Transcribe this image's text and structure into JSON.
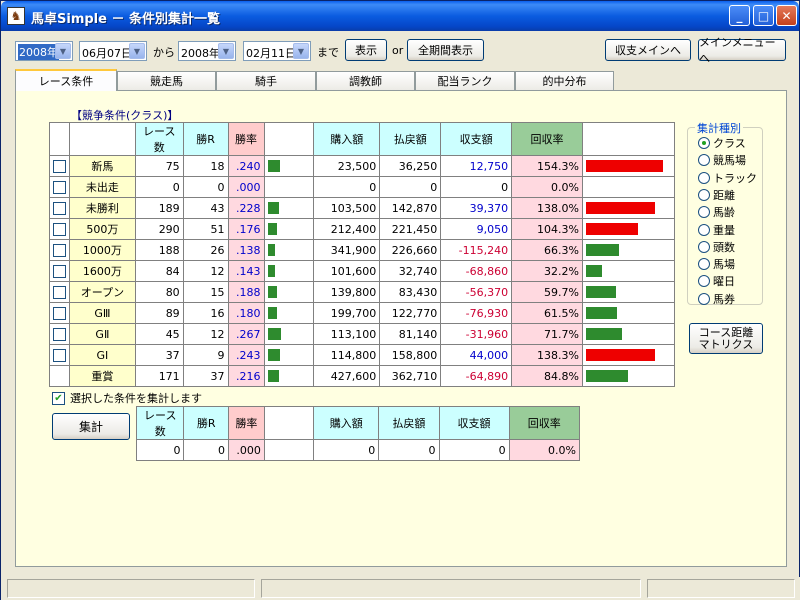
{
  "window": {
    "title": "馬卓Simple － 条件別集計一覧",
    "icon": "horse-app-icon",
    "min_glyph": "_",
    "max_glyph": "□",
    "close_glyph": "✕"
  },
  "filters": {
    "from_year": "2008年",
    "from_date": "06月07日",
    "from_label": "から",
    "to_year": "2008年",
    "to_date": "02月11日",
    "to_label": "まで",
    "show_button": "表示",
    "or_label": "or",
    "all_period_button": "全期間表示",
    "income_main_button": "収支メインへ",
    "main_menu_button": "メインメニューへ"
  },
  "tabs": [
    "レース条件",
    "競走馬",
    "騎手",
    "調教師",
    "配当ランク",
    "的中分布"
  ],
  "section_title": "【競争条件(クラス)】",
  "table": {
    "headers": [
      "レース数",
      "勝R",
      "勝率",
      "購入額",
      "払戻額",
      "収支額",
      "回収率"
    ],
    "rows": [
      {
        "label": "新馬",
        "races": "75",
        "wins": "18",
        "rate": ".240",
        "rate_value": 0.24,
        "buy": "23,500",
        "payout": "36,250",
        "balance": "12,750",
        "balance_sign": "pos",
        "recovery": "154.3%",
        "recovery_value": 154.3
      },
      {
        "label": "未出走",
        "races": "0",
        "wins": "0",
        "rate": ".000",
        "rate_value": 0.0,
        "buy": "0",
        "payout": "0",
        "balance": "0",
        "balance_sign": "zero",
        "recovery": "0.0%",
        "recovery_value": 0.0
      },
      {
        "label": "未勝利",
        "races": "189",
        "wins": "43",
        "rate": ".228",
        "rate_value": 0.228,
        "buy": "103,500",
        "payout": "142,870",
        "balance": "39,370",
        "balance_sign": "pos",
        "recovery": "138.0%",
        "recovery_value": 138.0
      },
      {
        "label": "500万",
        "races": "290",
        "wins": "51",
        "rate": ".176",
        "rate_value": 0.176,
        "buy": "212,400",
        "payout": "221,450",
        "balance": "9,050",
        "balance_sign": "pos",
        "recovery": "104.3%",
        "recovery_value": 104.3
      },
      {
        "label": "1000万",
        "races": "188",
        "wins": "26",
        "rate": ".138",
        "rate_value": 0.138,
        "buy": "341,900",
        "payout": "226,660",
        "balance": "-115,240",
        "balance_sign": "neg",
        "recovery": "66.3%",
        "recovery_value": 66.3
      },
      {
        "label": "1600万",
        "races": "84",
        "wins": "12",
        "rate": ".143",
        "rate_value": 0.143,
        "buy": "101,600",
        "payout": "32,740",
        "balance": "-68,860",
        "balance_sign": "neg",
        "recovery": "32.2%",
        "recovery_value": 32.2
      },
      {
        "label": "オープン",
        "races": "80",
        "wins": "15",
        "rate": ".188",
        "rate_value": 0.188,
        "buy": "139,800",
        "payout": "83,430",
        "balance": "-56,370",
        "balance_sign": "neg",
        "recovery": "59.7%",
        "recovery_value": 59.7
      },
      {
        "label": "GⅢ",
        "races": "89",
        "wins": "16",
        "rate": ".180",
        "rate_value": 0.18,
        "buy": "199,700",
        "payout": "122,770",
        "balance": "-76,930",
        "balance_sign": "neg",
        "recovery": "61.5%",
        "recovery_value": 61.5
      },
      {
        "label": "GⅡ",
        "races": "45",
        "wins": "12",
        "rate": ".267",
        "rate_value": 0.267,
        "buy": "113,100",
        "payout": "81,140",
        "balance": "-31,960",
        "balance_sign": "neg",
        "recovery": "71.7%",
        "recovery_value": 71.7
      },
      {
        "label": "GⅠ",
        "races": "37",
        "wins": "9",
        "rate": ".243",
        "rate_value": 0.243,
        "buy": "114,800",
        "payout": "158,800",
        "balance": "44,000",
        "balance_sign": "pos",
        "recovery": "138.3%",
        "recovery_value": 138.3
      },
      {
        "label": "重賞",
        "races": "171",
        "wins": "37",
        "rate": ".216",
        "rate_value": 0.216,
        "buy": "427,600",
        "payout": "362,710",
        "balance": "-64,890",
        "balance_sign": "neg",
        "recovery": "84.8%",
        "recovery_value": 84.8
      }
    ]
  },
  "selection": {
    "checkbox_label": "選択した条件を集計します",
    "checked": true,
    "aggregate_button": "集計",
    "summary": {
      "races": "0",
      "wins": "0",
      "rate": ".000",
      "buy": "0",
      "payout": "0",
      "balance": "0",
      "recovery": "0.0%"
    }
  },
  "aggregate_type": {
    "title": "集計種別",
    "options": [
      "クラス",
      "競馬場",
      "トラック",
      "距離",
      "馬齢",
      "重量",
      "頭数",
      "馬場",
      "曜日",
      "馬券"
    ],
    "selected": "クラス"
  },
  "course_matrix_button": [
    "コース距離",
    "マトリクス"
  ],
  "colors": {
    "positive": "#0000CC",
    "negative": "#CC0033",
    "win_bar": "#2E8B2E",
    "recovery_bar_high": "#EE0000",
    "recovery_bar_low": "#2E8B2E"
  }
}
